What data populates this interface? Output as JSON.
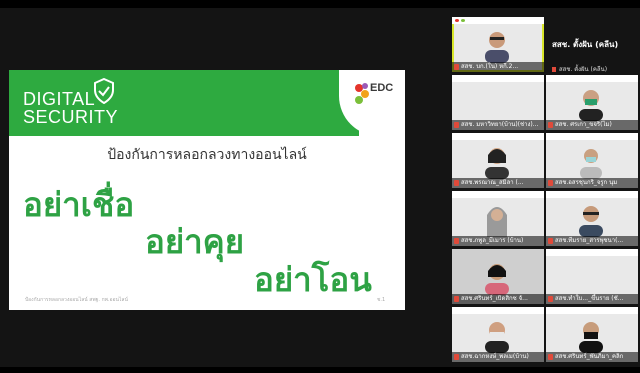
{
  "slide": {
    "brand_line1": "DIGITAL",
    "brand_line2": "SECURITY",
    "org_logo": "EDC",
    "subtitle": "ป้องกันการหลอกลวงทางออนไลน์",
    "line1": "อย่าเชื่อ",
    "line2": "อย่าคุย",
    "line3": "อย่าโอน",
    "footer": "ป้องกันการหลอกลวงออนไลน์ สพฐ. กพ.ออนไลน์",
    "page": "ช.1"
  },
  "speaker": {
    "name": "สสช. ตั้งฝัน (คลีน)",
    "sub": "สสช. ตั้งฝัน (คลีน)"
  },
  "participants": [
    {
      "label": "สสช. บก.(ใน) หกี.2..."
    },
    {
      "label": "สสช. ตั้งฝัน (คลีน)"
    },
    {
      "label": "สสช. มหาวิทยา(บ้าน)(ช่าง)..."
    },
    {
      "label": "สสช. ศรเกา_ขจริ(ไม)"
    },
    {
      "label": "สสช.พรณาณ_สมิลา (..."
    },
    {
      "label": "สสช.อสรชุนกริ_จรูก นุม"
    },
    {
      "label": "สสช.ภพูล_มีเมาร (บ้าน)"
    },
    {
      "label": "สสช.ทีมราย_สารพุชนา(..."
    },
    {
      "label": "สสช.ศรินทร์_เบิดสิกซ จั..."
    },
    {
      "label": "สสช.ทำใบ..._ขึ้นราย (ชั..."
    },
    {
      "label": "สสช.ฉากหงษ์_พลเม(บ้าน)"
    },
    {
      "label": "สสช.ศรินทร์_พันภิมา_คลิก"
    }
  ],
  "colors": {
    "brand_green": "#2eaa40",
    "speaker_highlight": "#d8e62a"
  }
}
